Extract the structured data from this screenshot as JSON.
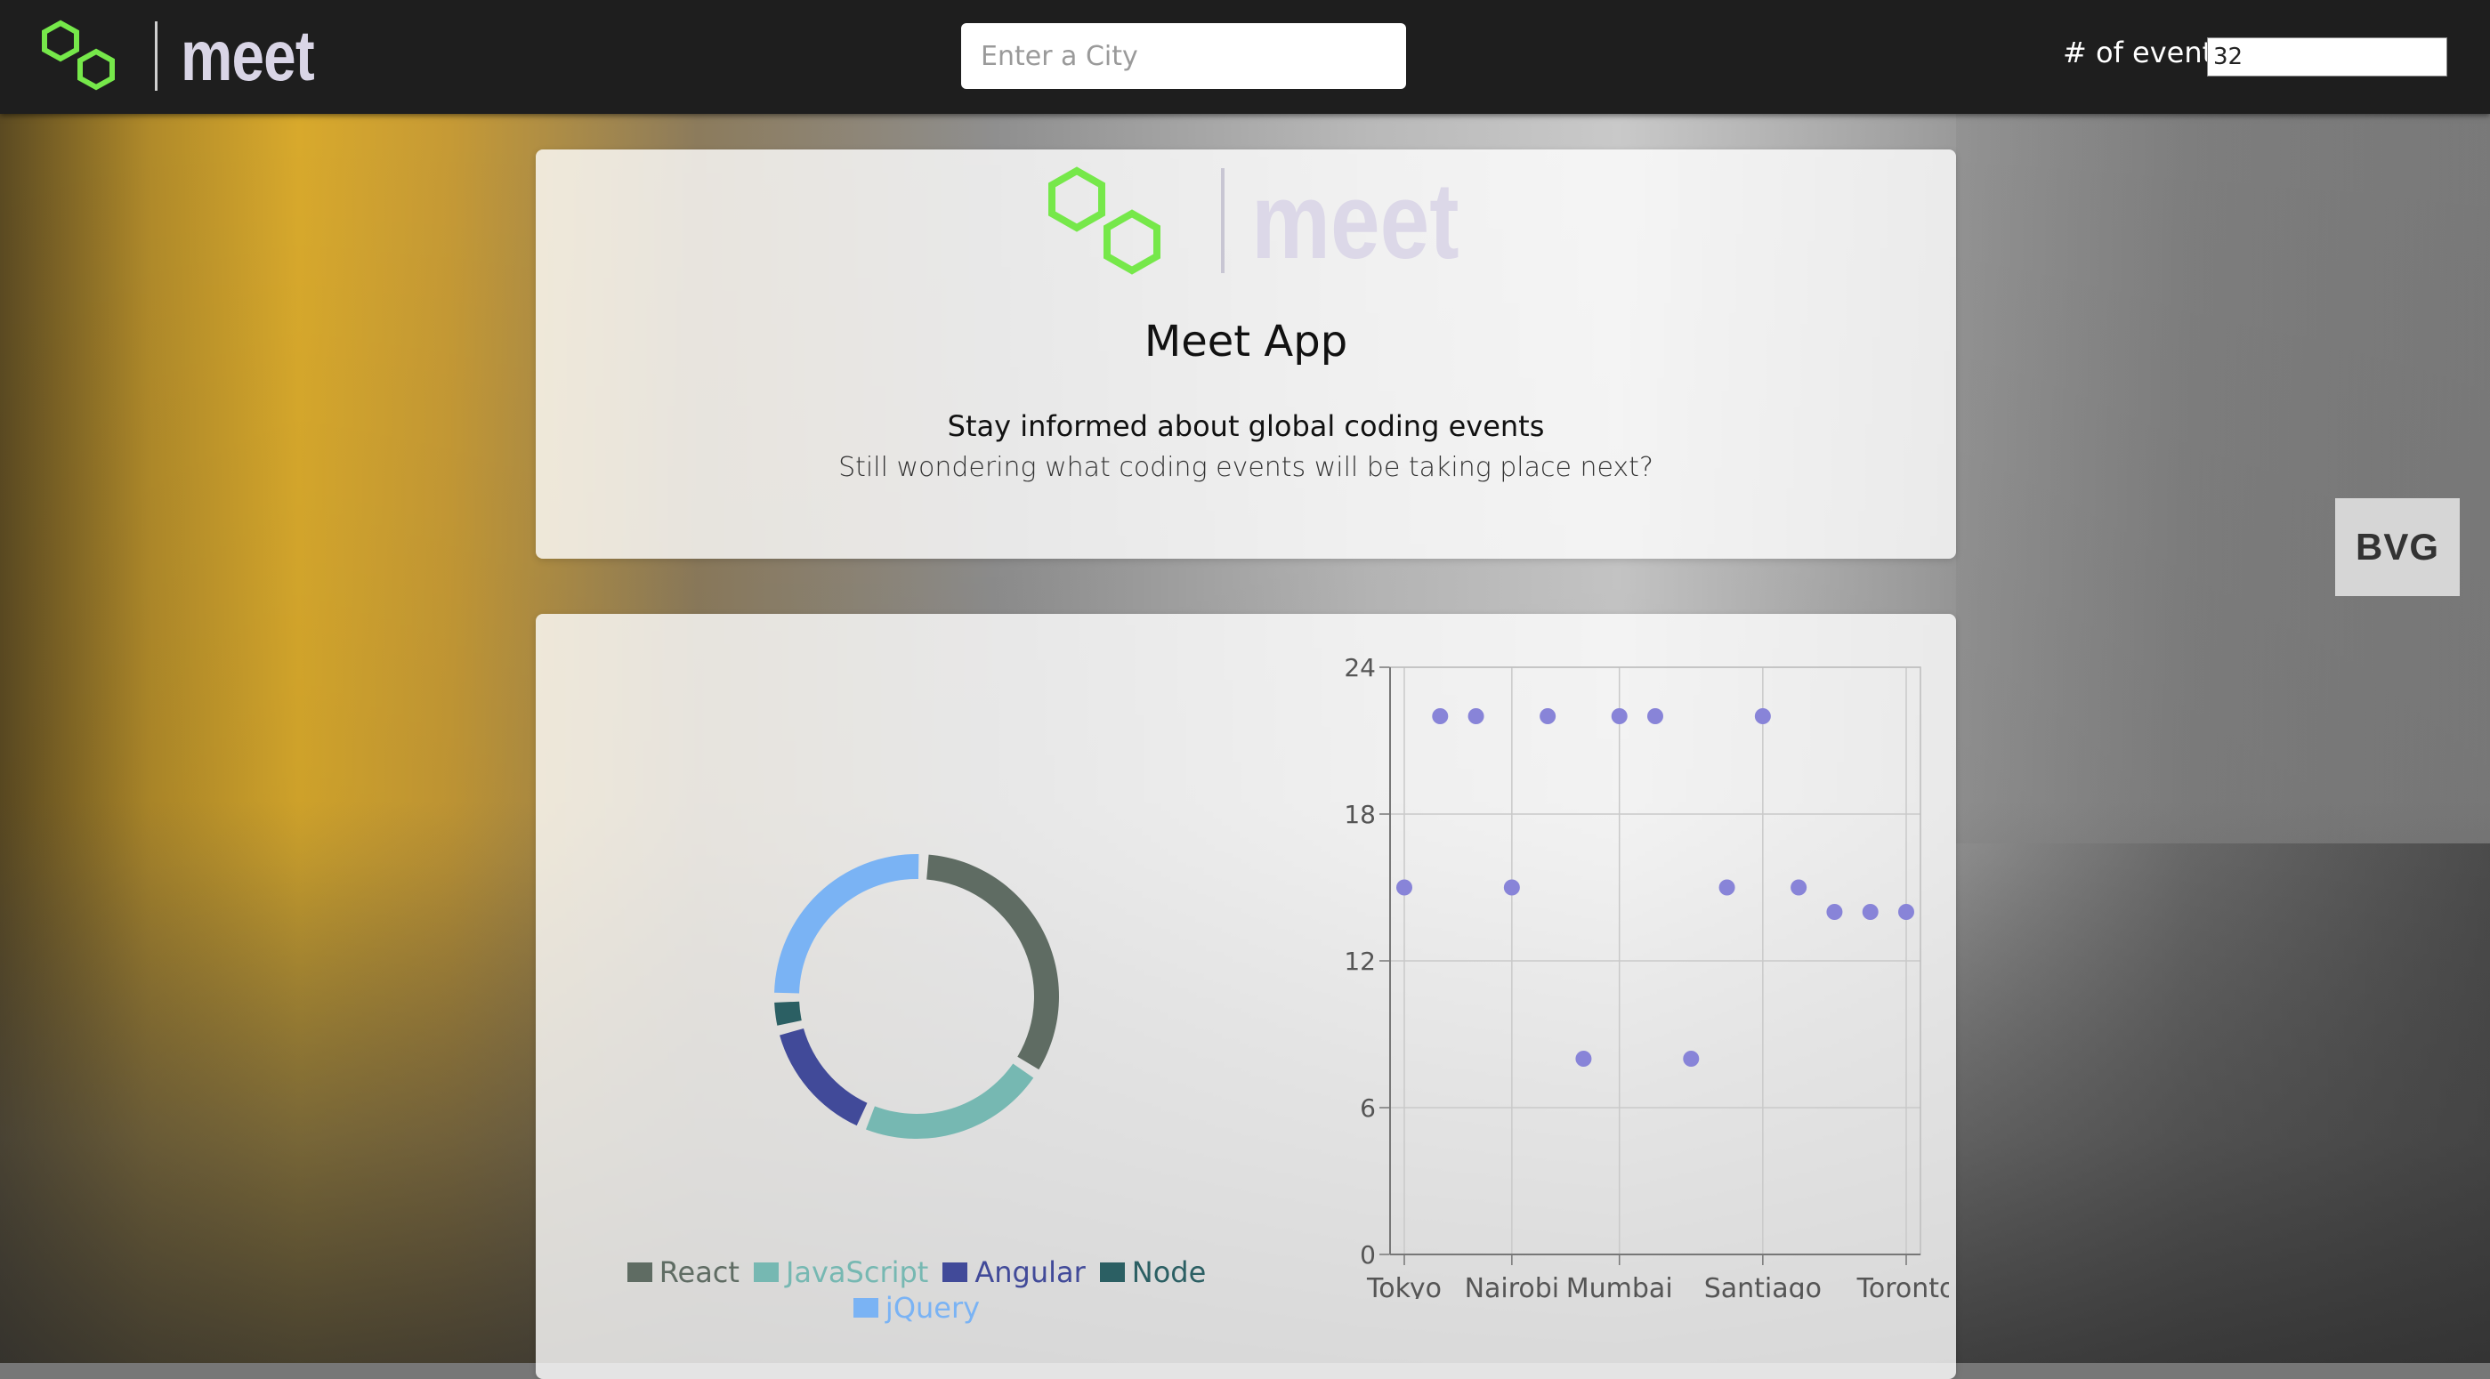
{
  "header": {
    "logo_text": "meet",
    "city_placeholder": "Enter a City",
    "events_label": "# of events",
    "events_value": "32"
  },
  "intro": {
    "logo_text": "meet",
    "title": "Meet App",
    "tagline": "Stay informed about global coding events",
    "subtitle": "Still wondering what coding events will be taking place next?"
  },
  "background": {
    "sign_text": "BVG"
  },
  "colors": {
    "logo_green": "#76e84a",
    "react": "#5f6c63",
    "javascript": "#76b8b2",
    "angular": "#414a99",
    "node": "#2b5f63",
    "jquery": "#7ab3f4",
    "scatter_point": "#8884d8"
  },
  "chart_data": [
    {
      "type": "pie",
      "style": "donut",
      "labels": [
        "React",
        "JavaScript",
        "Angular",
        "Node",
        "jQuery"
      ],
      "values": [
        9,
        6,
        4,
        1,
        7
      ],
      "legend_placement": "bottom"
    },
    {
      "type": "scatter",
      "xlabel": "",
      "ylabel": "",
      "x_tick_labels": [
        "Tokyo",
        "Nairobi",
        "Mumbai",
        "Santiago",
        "Toronto"
      ],
      "points": [
        {
          "x": 0,
          "y": 15
        },
        {
          "x": 1,
          "y": 22
        },
        {
          "x": 2,
          "y": 22
        },
        {
          "x": 3,
          "y": 15
        },
        {
          "x": 4,
          "y": 22
        },
        {
          "x": 5,
          "y": 8
        },
        {
          "x": 6,
          "y": 22
        },
        {
          "x": 7,
          "y": 22
        },
        {
          "x": 8,
          "y": 8
        },
        {
          "x": 9,
          "y": 15
        },
        {
          "x": 10,
          "y": 22
        },
        {
          "x": 11,
          "y": 15
        },
        {
          "x": 12,
          "y": 14
        },
        {
          "x": 13,
          "y": 14
        },
        {
          "x": 14,
          "y": 14
        }
      ],
      "x_tick_positions": [
        0,
        3,
        6,
        10,
        14
      ],
      "ylim": [
        0,
        24
      ],
      "y_ticks": [
        0,
        6,
        12,
        18,
        24
      ],
      "grid": true
    }
  ]
}
